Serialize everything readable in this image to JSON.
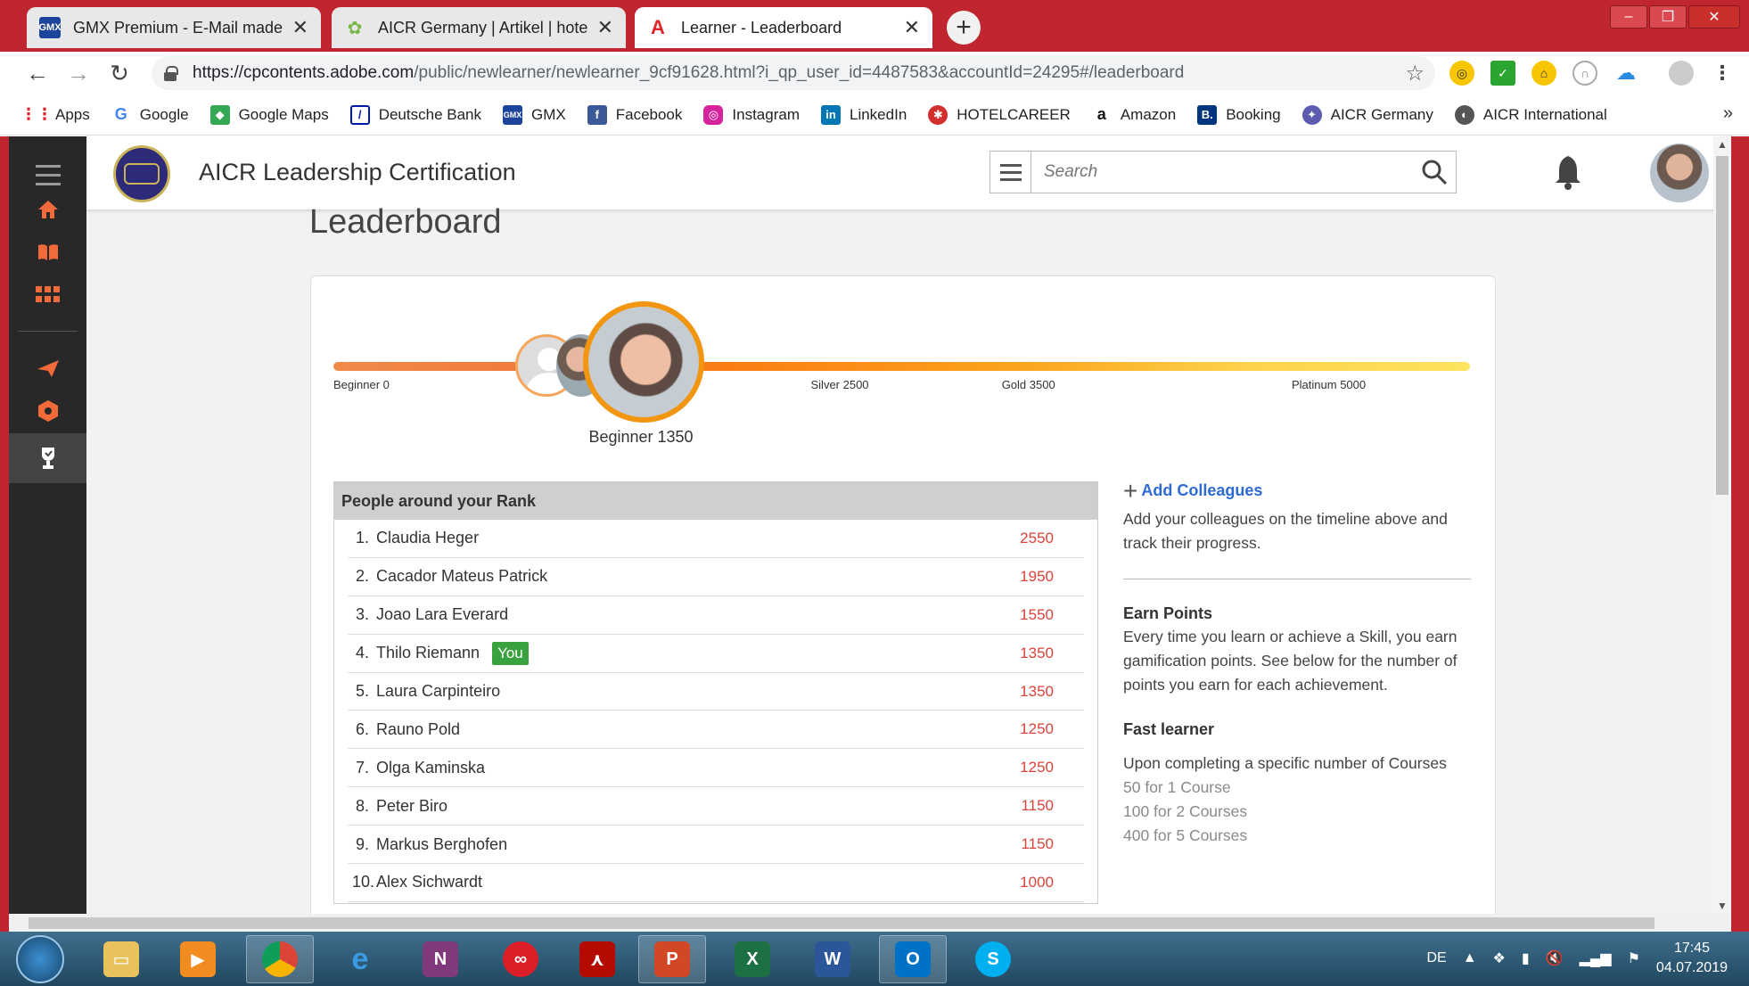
{
  "browser": {
    "tabs": [
      {
        "title": "GMX Premium - E-Mail made in G",
        "icon": "gmx-icon",
        "active": false
      },
      {
        "title": "AICR Germany | Artikel | hotelkit",
        "icon": "hotelkit-icon",
        "active": false
      },
      {
        "title": "Learner - Leaderboard",
        "icon": "adobe-icon",
        "active": true
      }
    ],
    "url_host": "https://cpcontents.adobe.com",
    "url_path": "/public/newlearner/newlearner_9cf91628.html?i_qp_user_id=4487583&accountId=24295#/leaderboard",
    "bookmarks": [
      "Apps",
      "Google",
      "Google Maps",
      "Deutsche Bank",
      "GMX",
      "Facebook",
      "Instagram",
      "LinkedIn",
      "HOTELCAREER",
      "Amazon",
      "Booking",
      "AICR Germany",
      "AICR International"
    ],
    "bookmarks_more": "»"
  },
  "app": {
    "title": "AICR Leadership Certification",
    "search_placeholder": "Search",
    "page_title": "Leaderboard"
  },
  "progress": {
    "levels": [
      {
        "label": "Beginner 0",
        "points": 0
      },
      {
        "label": "Silver 2500",
        "points": 2500
      },
      {
        "label": "Gold 3500",
        "points": 3500
      },
      {
        "label": "Platinum 5000",
        "points": 5000
      }
    ],
    "current_label": "Beginner 1350",
    "current_points": 1350
  },
  "rank": {
    "header": "People around your Rank",
    "you_badge": "You",
    "rows": [
      {
        "num": "1.",
        "name": "Claudia Heger",
        "points": "2550",
        "you": false
      },
      {
        "num": "2.",
        "name": "Cacador Mateus Patrick",
        "points": "1950",
        "you": false
      },
      {
        "num": "3.",
        "name": "Joao Lara Everard",
        "points": "1550",
        "you": false
      },
      {
        "num": "4.",
        "name": "Thilo Riemann",
        "points": "1350",
        "you": true
      },
      {
        "num": "5.",
        "name": "Laura Carpinteiro",
        "points": "1350",
        "you": false
      },
      {
        "num": "6.",
        "name": "Rauno Pold",
        "points": "1250",
        "you": false
      },
      {
        "num": "7.",
        "name": "Olga Kaminska",
        "points": "1250",
        "you": false
      },
      {
        "num": "8.",
        "name": "Peter Biro",
        "points": "1150",
        "you": false
      },
      {
        "num": "9.",
        "name": "Markus Berghofen",
        "points": "1150",
        "you": false
      },
      {
        "num": "10.",
        "name": "Alex Sichwardt",
        "points": "1000",
        "you": false
      }
    ]
  },
  "panel": {
    "add_colleagues": "Add Colleagues",
    "add_desc": "Add your colleagues on the timeline above and track their progress.",
    "earn_title": "Earn Points",
    "earn_desc": "Every time you learn or achieve a Skill, you earn gamification points. See below for the number of points you earn for each achievement.",
    "fast_title": "Fast learner",
    "fast_desc": "Upon completing a specific number of Courses",
    "fast_items": [
      "50 for 1 Course",
      "100 for 2 Courses",
      "400 for 5 Courses"
    ]
  },
  "taskbar": {
    "lang": "DE",
    "time": "17:45",
    "date": "04.07.2019"
  },
  "colors": {
    "accent": "#f29511",
    "points": "#d9433a",
    "link": "#2d6ad4",
    "you_badge": "#3aa13f"
  }
}
